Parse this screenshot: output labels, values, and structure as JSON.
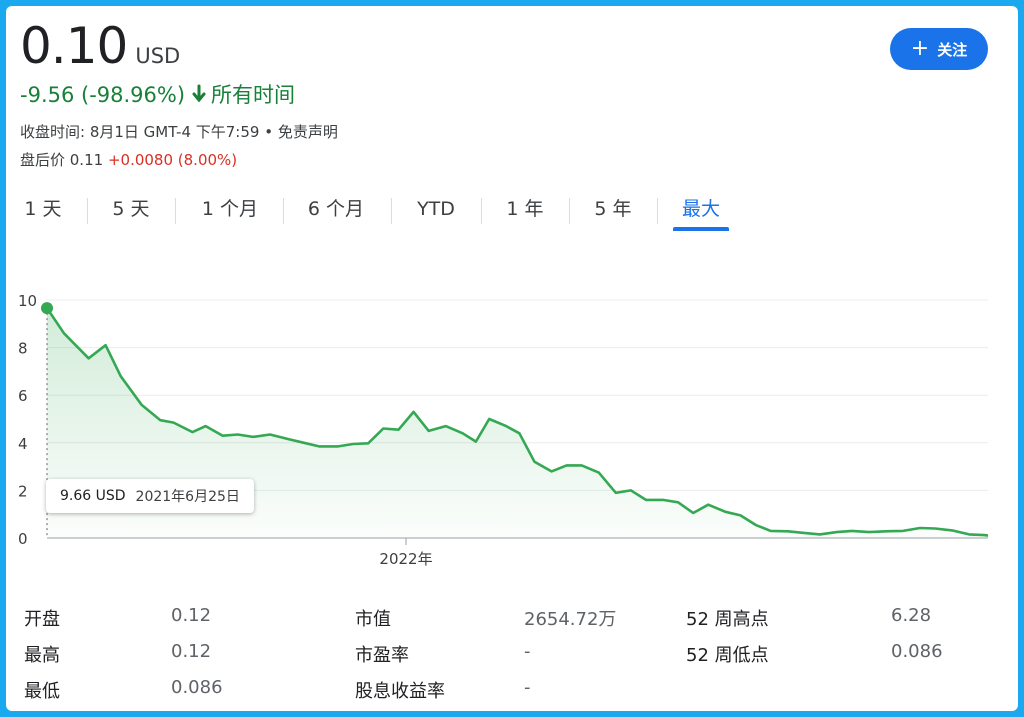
{
  "quote": {
    "price": "0.10",
    "currency": "USD",
    "change": "-9.56 (-98.96%)",
    "change_direction_icon": "arrow-down-icon",
    "period_label": "所有时间",
    "close_time": "收盘时间: 8月1日 GMT-4 下午7:59 • 免责声明",
    "after_hours_label": "盘后价 0.11",
    "after_hours_change": "+0.0080 (8.00%)"
  },
  "follow_button": {
    "icon": "plus-icon",
    "label": "关注"
  },
  "tabs": [
    {
      "label": "1 天",
      "active": false
    },
    {
      "label": "5 天",
      "active": false
    },
    {
      "label": "1 个月",
      "active": false
    },
    {
      "label": "6 个月",
      "active": false
    },
    {
      "label": "YTD",
      "active": false
    },
    {
      "label": "1 年",
      "active": false
    },
    {
      "label": "5 年",
      "active": false
    },
    {
      "label": "最大",
      "active": true
    }
  ],
  "tooltip": {
    "value": "9.66 USD",
    "date": "2021年6月25日"
  },
  "stats": [
    {
      "label": "开盘",
      "value": "0.12"
    },
    {
      "label": "最高",
      "value": "0.12"
    },
    {
      "label": "最低",
      "value": "0.086"
    },
    {
      "label": "市值",
      "value": "2654.72万"
    },
    {
      "label": "市盈率",
      "value": "-"
    },
    {
      "label": "股息收益率",
      "value": "-"
    },
    {
      "label": "52 周高点",
      "value": "6.28"
    },
    {
      "label": "52 周低点",
      "value": "0.086"
    }
  ],
  "colors": {
    "line": "#34a853",
    "positive": "#d93025",
    "negative": "#188038",
    "accent": "#1a73e8"
  },
  "chart_data": {
    "type": "line",
    "ylim": [
      0,
      10
    ],
    "yticks": [
      0,
      2,
      4,
      6,
      8,
      10
    ],
    "ytick_labels": [
      "0",
      "2",
      "4",
      "6",
      "8",
      "10"
    ],
    "x_start": "2021-06-25",
    "x_end": "2022-08-01",
    "xtick_labels": [
      {
        "label": "2022年",
        "date": "2022-01-01"
      }
    ],
    "highlight": {
      "date": "2021-06-25",
      "value": 9.66
    },
    "grid": true,
    "series": [
      {
        "points": [
          [
            "2021-06-25",
            9.66
          ],
          [
            "2021-07-04",
            8.6
          ],
          [
            "2021-07-17",
            7.55
          ],
          [
            "2021-07-26",
            8.1
          ],
          [
            "2021-08-03",
            6.8
          ],
          [
            "2021-08-14",
            5.6
          ],
          [
            "2021-08-24",
            4.95
          ],
          [
            "2021-08-31",
            4.85
          ],
          [
            "2021-09-10",
            4.45
          ],
          [
            "2021-09-17",
            4.7
          ],
          [
            "2021-09-26",
            4.3
          ],
          [
            "2021-10-04",
            4.35
          ],
          [
            "2021-10-12",
            4.25
          ],
          [
            "2021-10-21",
            4.35
          ],
          [
            "2021-10-31",
            4.15
          ],
          [
            "2021-11-08",
            4.0
          ],
          [
            "2021-11-16",
            3.85
          ],
          [
            "2021-11-26",
            3.85
          ],
          [
            "2021-12-04",
            3.95
          ],
          [
            "2021-12-12",
            3.98
          ],
          [
            "2021-12-20",
            4.6
          ],
          [
            "2021-12-28",
            4.55
          ],
          [
            "2022-01-05",
            5.3
          ],
          [
            "2022-01-13",
            4.5
          ],
          [
            "2022-01-22",
            4.7
          ],
          [
            "2022-01-31",
            4.4
          ],
          [
            "2022-02-07",
            4.05
          ],
          [
            "2022-02-14",
            5.0
          ],
          [
            "2022-02-23",
            4.7
          ],
          [
            "2022-03-02",
            4.4
          ],
          [
            "2022-03-10",
            3.2
          ],
          [
            "2022-03-19",
            2.8
          ],
          [
            "2022-03-27",
            3.05
          ],
          [
            "2022-04-04",
            3.05
          ],
          [
            "2022-04-13",
            2.75
          ],
          [
            "2022-04-22",
            1.9
          ],
          [
            "2022-04-30",
            2.0
          ],
          [
            "2022-05-08",
            1.6
          ],
          [
            "2022-05-17",
            1.6
          ],
          [
            "2022-05-25",
            1.5
          ],
          [
            "2022-06-02",
            1.05
          ],
          [
            "2022-06-10",
            1.4
          ],
          [
            "2022-06-19",
            1.1
          ],
          [
            "2022-06-27",
            0.95
          ],
          [
            "2022-07-05",
            0.55
          ],
          [
            "2022-07-13",
            0.3
          ],
          [
            "2022-07-22",
            0.28
          ],
          [
            "2022-07-30",
            0.22
          ],
          [
            "2022-08-08",
            0.15
          ],
          [
            "2022-08-17",
            0.25
          ],
          [
            "2022-08-25",
            0.3
          ],
          [
            "2022-09-03",
            0.25
          ],
          [
            "2022-09-12",
            0.28
          ],
          [
            "2022-09-21",
            0.3
          ],
          [
            "2022-09-30",
            0.42
          ],
          [
            "2022-10-08",
            0.4
          ],
          [
            "2022-10-17",
            0.32
          ],
          [
            "2022-10-26",
            0.15
          ],
          [
            "2022-11-03",
            0.12
          ],
          [
            "2022-11-05",
            0.1
          ]
        ]
      }
    ]
  }
}
